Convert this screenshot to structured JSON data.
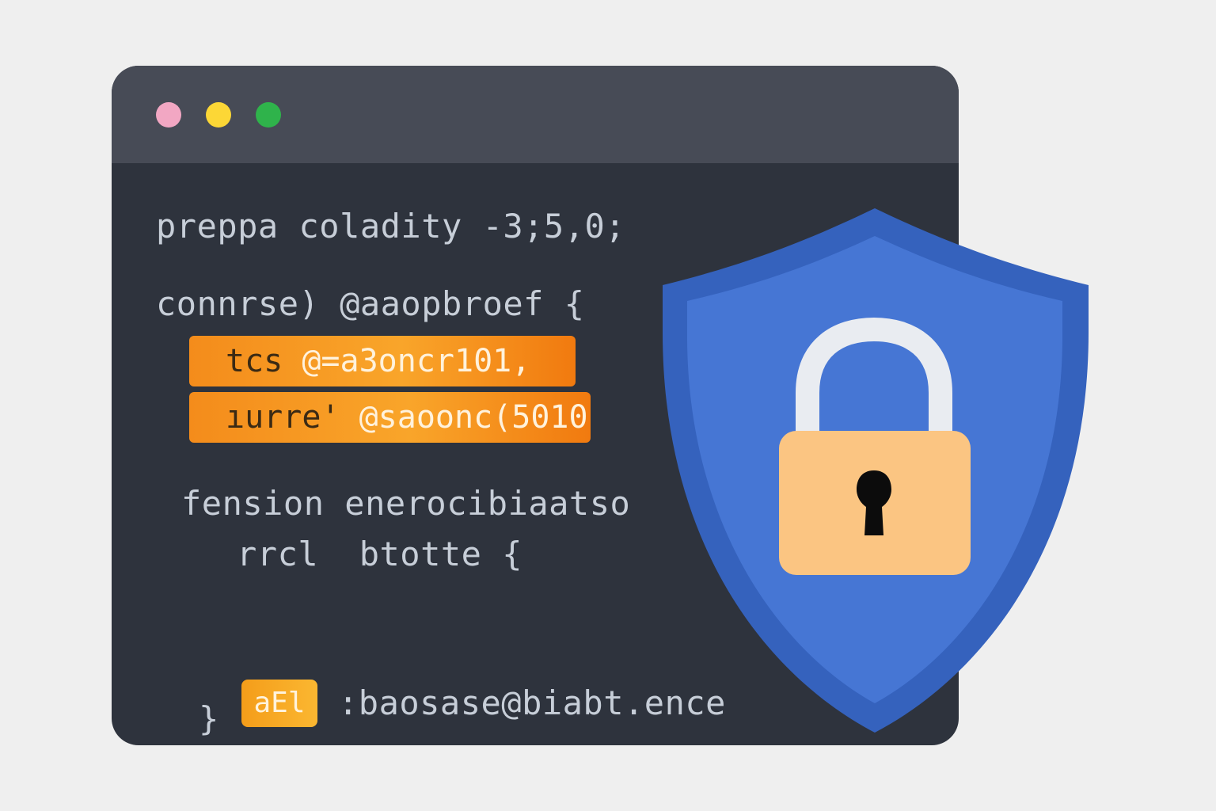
{
  "window": {
    "colors": {
      "titlebar": "#474b56",
      "editor_bg": "#2e333d",
      "close": "#f2a7c3",
      "minimize": "#fcd736",
      "maximize": "#2fb34b",
      "highlight": "#f7941d",
      "shield": "#3562bd",
      "shield_inner": "#4676d4",
      "lock_body": "#fbc582"
    }
  },
  "code": {
    "line1": "preppa coladity -3;5,0;",
    "line2": "connrse) @aaopbroef {",
    "hl1_key": "tcs",
    "hl1_value": "@=a3oncr101,",
    "hl2_key": "ıurre'",
    "hl2_value": "@saoonc(5010",
    "line3": "fension enerocibiaatso",
    "line4": "rrcl  btotte {",
    "chip_label": "aEl",
    "line5": ":baosase@biabt.ence",
    "close1": "}",
    "close2": "}"
  },
  "badge": {
    "shield_icon": "shield-icon",
    "lock_icon": "padlock-icon"
  }
}
